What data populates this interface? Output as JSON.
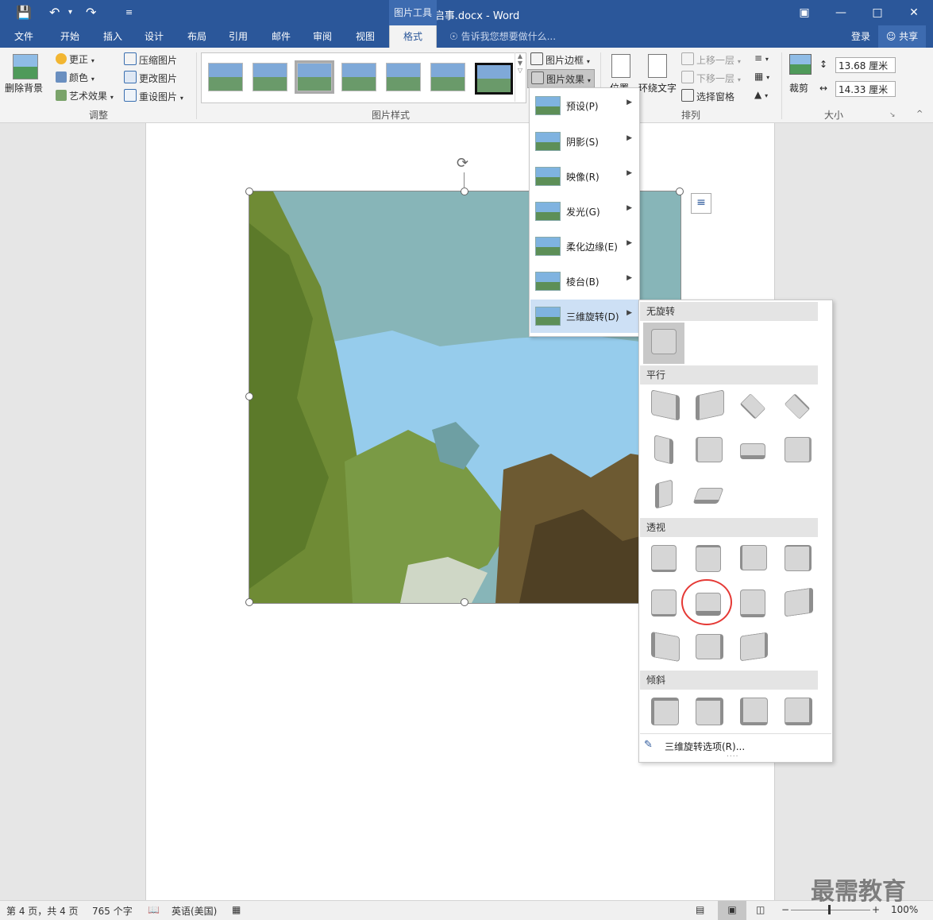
{
  "title_bar": {
    "document_title": "招聘启事.docx - Word",
    "context_tab": "图片工具",
    "quick_access": [
      "save-icon",
      "undo-icon",
      "redo-icon",
      "customize-icon"
    ]
  },
  "tabs": {
    "items": [
      "文件",
      "开始",
      "插入",
      "设计",
      "布局",
      "引用",
      "邮件",
      "审阅",
      "视图",
      "格式"
    ],
    "active": "格式",
    "tell_me": "告诉我您想要做什么...",
    "login": "登录",
    "share": "共享"
  },
  "ribbon": {
    "adjust": {
      "remove_bg": "删除背景",
      "corrections": "更正",
      "color": "颜色",
      "artistic": "艺术效果",
      "compress": "压缩图片",
      "change": "更改图片",
      "reset": "重设图片",
      "label": "调整"
    },
    "styles": {
      "label": "图片样式",
      "border": "图片边框",
      "effects": "图片效果"
    },
    "arrange": {
      "position": "位置",
      "wrap": "环绕文字",
      "forward": "上移一层",
      "backward": "下移一层",
      "selection_pane": "选择窗格",
      "label": "排列"
    },
    "size": {
      "crop": "裁剪",
      "height": "13.68 厘米",
      "width": "14.33 厘米",
      "label": "大小"
    }
  },
  "effects_menu": {
    "items": [
      "预设(P)",
      "阴影(S)",
      "映像(R)",
      "发光(G)",
      "柔化边缘(E)",
      "棱台(B)",
      "三维旋转(D)"
    ],
    "active_index": 6
  },
  "rotation_menu": {
    "sections": [
      "无旋转",
      "平行",
      "透视",
      "倾斜"
    ],
    "options_link": "三维旋转选项(R)...",
    "highlighted": "perspective-item-6"
  },
  "status_bar": {
    "page": "第 4 页，共 4 页",
    "words": "765 个字",
    "language": "英语(美国)",
    "zoom": "100%"
  },
  "watermark": "最需教育",
  "colors": {
    "brand": "#2b579a",
    "active_menu": "#cde0f5",
    "highlight_circle": "#e53935"
  }
}
